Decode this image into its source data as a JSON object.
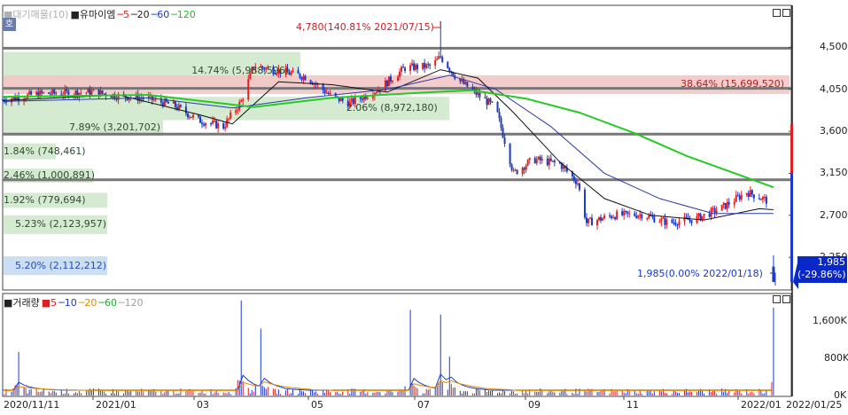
{
  "price_panel": {
    "legend": [
      {
        "text": "■대기매물(10)",
        "color": "#b0b0b0"
      },
      {
        "text": "■유마이엠",
        "color": "#222222"
      },
      {
        "text": "─5",
        "color": "#e02020"
      },
      {
        "text": "─20",
        "color": "#222222"
      },
      {
        "text": "─60",
        "color": "#1a3acc"
      },
      {
        "text": "─120",
        "color": "#22bb22"
      }
    ],
    "side_tab": "호",
    "max_annotation": "4,780(140.81% 2021/07/15)",
    "min_annotation": "1,985(0.00% 2022/01/18)",
    "current_price": "1,985",
    "current_change": "(-29.86%)"
  },
  "volume_panel": {
    "legend": [
      {
        "text": "■거래량",
        "color": "#222222"
      },
      {
        "text": "■5",
        "color": "#e02020"
      },
      {
        "text": "─10",
        "color": "#1a3acc"
      },
      {
        "text": "─20",
        "color": "#e08a00"
      },
      {
        "text": "─60",
        "color": "#22aa22"
      },
      {
        "text": "─120",
        "color": "#a0a0a0"
      }
    ]
  },
  "colors": {
    "up": "#e02020",
    "down": "#1a3acc",
    "ma5": "#e02020",
    "ma20": "#111111",
    "ma60": "#2a3aa8",
    "ma120": "#22cc22",
    "zone_green": "#cfe8cc",
    "zone_pink": "#f4c6c6",
    "zone_blue": "#c4dcf0"
  },
  "chart_data": [
    {
      "type": "candlestick",
      "title": "",
      "y_ticks": [
        2250,
        2700,
        3150,
        3600,
        4050,
        4500
      ],
      "y_tick_labels": [
        "2,250",
        "2,700",
        "3,150",
        "3,600",
        "4,050",
        "4,500"
      ],
      "ylim": [
        1900,
        4950
      ],
      "x_tick_labels": [
        "2020/11/11",
        "2021/01",
        "03",
        "05",
        "07",
        "09",
        "11",
        "2022/01",
        "2022/01/25"
      ],
      "x_range": [
        "2020/11/11",
        "2022/01/25"
      ],
      "series": [
        {
          "name": "유마이엠",
          "kind": "close",
          "points": [
            [
              "2020-11-11",
              3940
            ],
            [
              "2020-12-01",
              4000
            ],
            [
              "2021-01-01",
              4020
            ],
            [
              "2021-01-15",
              3980
            ],
            [
              "2021-02-01",
              3950
            ],
            [
              "2021-02-15",
              3880
            ],
            [
              "2021-03-01",
              3720
            ],
            [
              "2021-03-15",
              3650
            ],
            [
              "2021-03-25",
              3920
            ],
            [
              "2021-04-01",
              4300
            ],
            [
              "2021-04-15",
              4250
            ],
            [
              "2021-05-01",
              4180
            ],
            [
              "2021-05-15",
              3970
            ],
            [
              "2021-05-25",
              3900
            ],
            [
              "2021-06-10",
              4050
            ],
            [
              "2021-06-25",
              4280
            ],
            [
              "2021-07-10",
              4300
            ],
            [
              "2021-07-15",
              4400
            ],
            [
              "2021-07-25",
              4150
            ],
            [
              "2021-08-05",
              3990
            ],
            [
              "2021-08-15",
              3850
            ],
            [
              "2021-08-25",
              3150
            ],
            [
              "2021-09-05",
              3300
            ],
            [
              "2021-09-20",
              3250
            ],
            [
              "2021-09-30",
              3050
            ],
            [
              "2021-10-05",
              2620
            ],
            [
              "2021-10-20",
              2700
            ],
            [
              "2021-11-05",
              2710
            ],
            [
              "2021-11-20",
              2620
            ],
            [
              "2021-12-05",
              2660
            ],
            [
              "2021-12-20",
              2780
            ],
            [
              "2022-01-03",
              2950
            ],
            [
              "2022-01-12",
              2880
            ],
            [
              "2022-01-17",
              2830
            ],
            [
              "2022-01-18",
              1985
            ]
          ]
        },
        {
          "name": "5",
          "kind": "ma"
        },
        {
          "name": "20",
          "kind": "ma",
          "points": [
            [
              "2020-11-11",
              3930
            ],
            [
              "2021-01-15",
              3990
            ],
            [
              "2021-03-01",
              3780
            ],
            [
              "2021-03-20",
              3680
            ],
            [
              "2021-04-15",
              4130
            ],
            [
              "2021-05-15",
              4100
            ],
            [
              "2021-06-15",
              4020
            ],
            [
              "2021-07-15",
              4260
            ],
            [
              "2021-08-05",
              4170
            ],
            [
              "2021-08-25",
              3800
            ],
            [
              "2021-09-20",
              3270
            ],
            [
              "2021-10-15",
              2880
            ],
            [
              "2021-11-10",
              2700
            ],
            [
              "2021-12-10",
              2650
            ],
            [
              "2022-01-10",
              2770
            ],
            [
              "2022-01-18",
              2760
            ]
          ]
        },
        {
          "name": "60",
          "kind": "ma",
          "points": [
            [
              "2020-11-11",
              3920
            ],
            [
              "2021-02-01",
              3960
            ],
            [
              "2021-03-20",
              3850
            ],
            [
              "2021-05-01",
              3960
            ],
            [
              "2021-06-15",
              4050
            ],
            [
              "2021-07-20",
              4200
            ],
            [
              "2021-08-15",
              4050
            ],
            [
              "2021-09-15",
              3650
            ],
            [
              "2021-10-15",
              3150
            ],
            [
              "2021-11-15",
              2880
            ],
            [
              "2021-12-15",
              2720
            ],
            [
              "2022-01-18",
              2720
            ]
          ]
        },
        {
          "name": "120",
          "kind": "ma",
          "points": [
            [
              "2020-11-11",
              3970
            ],
            [
              "2021-02-01",
              3990
            ],
            [
              "2021-04-01",
              3860
            ],
            [
              "2021-05-15",
              3960
            ],
            [
              "2021-07-01",
              4010
            ],
            [
              "2021-08-01",
              4040
            ],
            [
              "2021-09-01",
              3950
            ],
            [
              "2021-10-01",
              3800
            ],
            [
              "2021-11-01",
              3580
            ],
            [
              "2021-12-01",
              3330
            ],
            [
              "2022-01-18",
              3000
            ]
          ]
        }
      ],
      "price_zones": [
        {
          "label": "14.74% (5,988,596)",
          "low": 4050,
          "high": 4450,
          "color": "green"
        },
        {
          "label": "38.64% (15,699,520)",
          "low": 4000,
          "high": 4200,
          "color": "pink"
        },
        {
          "label": "2.06% (8,972,180)",
          "low": 3720,
          "high": 3970,
          "color": "green"
        },
        {
          "label": "7.89% (3,201,702)",
          "low": 3550,
          "high": 3720,
          "color": "green"
        },
        {
          "label": "1.84% (748,461)",
          "low": 3300,
          "high": 3470,
          "color": "green"
        },
        {
          "label": "2.46% (1,000,891)",
          "low": 3050,
          "high": 3200,
          "color": "green"
        },
        {
          "label": "1.92% (779,694)",
          "low": 2780,
          "high": 2940,
          "color": "green"
        },
        {
          "label": "5.23% (2,123,957)",
          "low": 2500,
          "high": 2700,
          "color": "green"
        },
        {
          "label": "5.20% (2,112,212)",
          "low": 2060,
          "high": 2260,
          "color": "blue"
        }
      ],
      "horizontal_levels": [
        4490,
        4060,
        3570,
        3080
      ],
      "max_point": {
        "date": "2021-07-15",
        "value": 4780,
        "label": "4,780(140.81% 2021/07/15)"
      },
      "min_point": {
        "date": "2022-01-18",
        "value": 1985,
        "label": "1,985(0.00% 2022/01/18)"
      }
    },
    {
      "type": "bar",
      "title": "거래량",
      "y_ticks": [
        0,
        800000,
        1600000
      ],
      "y_tick_labels": [
        "0K",
        "800K",
        "1,600K"
      ],
      "ylim": [
        0,
        2200000
      ],
      "spikes": [
        [
          "2020-11-20",
          950000
        ],
        [
          "2021-03-25",
          2050000
        ],
        [
          "2021-04-05",
          1450000
        ],
        [
          "2021-06-28",
          1850000
        ],
        [
          "2021-07-15",
          1750000
        ],
        [
          "2021-07-20",
          850000
        ],
        [
          "2022-01-18",
          1900000
        ]
      ],
      "baseline_volume": 120000
    }
  ]
}
